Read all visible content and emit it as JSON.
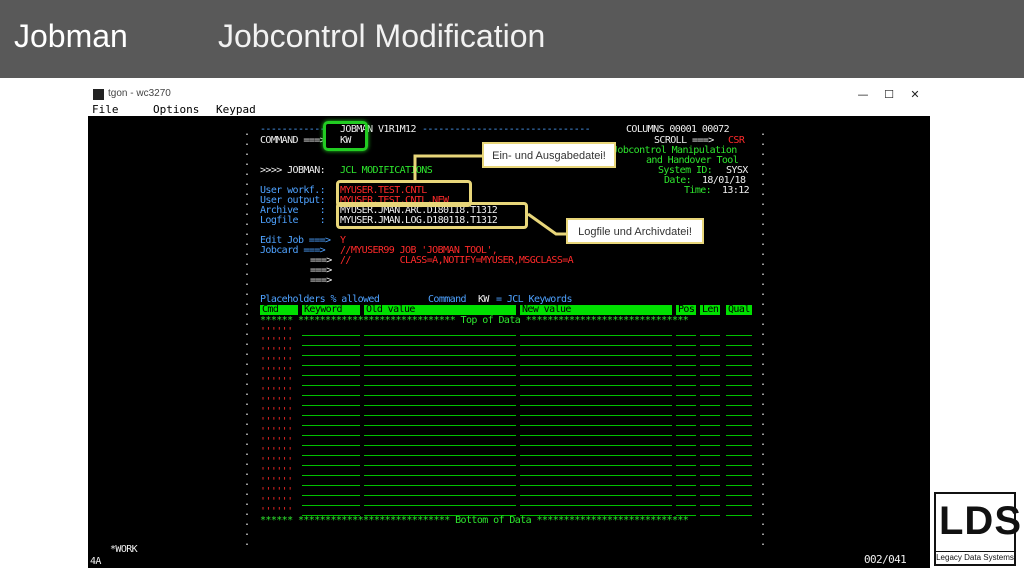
{
  "header": {
    "app_title": "Jobman",
    "page_title": "Jobcontrol Modification"
  },
  "window": {
    "title": "tgon - wc3270",
    "controls": [
      "—",
      "☐",
      "✕"
    ],
    "menu": [
      "File",
      "Options",
      "Keypad"
    ]
  },
  "terminal": {
    "banner_left": "------------",
    "banner_name": "JOBMAN V1R1M12",
    "banner_dashes": "-------------------------------",
    "columns": "COLUMNS 00001 00072",
    "command_label": "COMMAND ===>",
    "command_value": "KW",
    "scroll_label": "SCROLL ===>",
    "scroll_value": "CSR",
    "desc1": "Jobcontrol Manipulation",
    "desc2": "and Handover Tool",
    "sysid_label": "System ID:",
    "sysid_value": "SYSX",
    "date_label": "Date:",
    "date_value": "18/01/18",
    "time_label": "Time:",
    "time_value": "13:12",
    "jobman_prefix": ">>>> JOBMAN:",
    "jobman_mode": "JCL MODIFICATIONS",
    "fields": [
      {
        "label": "User workf.:",
        "value": "MYUSER.TEST.CNTL"
      },
      {
        "label": "User output:",
        "value": "MYUSER.TEST.CNTL.NEW"
      },
      {
        "label": "Archive    :",
        "value": "MYUSER.JMAN.ARC.D180118.T1312"
      },
      {
        "label": "Logfile    :",
        "value": "MYUSER.JMAN.LOG.D180118.T1312"
      }
    ],
    "editjob_label": "Edit Job ===>",
    "editjob_value": "Y",
    "jobcard_label": "Jobcard ===>",
    "jobcard_lines": [
      "//MYUSER99 JOB 'JOBMAN TOOL',",
      "//         CLASS=A,NOTIFY=MYUSER,MSGCLASS=A",
      "",
      ""
    ],
    "arrow": "===>",
    "placeholders": "Placeholders % allowed",
    "command_hint_label": "Command",
    "command_hint_kw": "KW",
    "command_hint_text": "= JCL Keywords",
    "columns_header": [
      "Cmd",
      "Keyword",
      "Old value",
      "New value",
      "Pos",
      "Len",
      "Qual"
    ],
    "top_of_data": "****** ***************************** Top of Data ******************************",
    "bottom_of_data": "****** **************************** Bottom of Data ****************************",
    "row_marker": "''''''",
    "status_left": "*WORK",
    "status_mode": "4A",
    "status_right": "002/041"
  },
  "callouts": {
    "io_datasets": "Ein- und Ausgabedatei!",
    "log_archive": "Logfile und Archivdatei!"
  },
  "logo": {
    "mark": "LDS",
    "subtitle": "Legacy Data Systems"
  },
  "colors": {
    "header_bg": "#595959",
    "terminal_bg": "#000000",
    "term_green": "#00e000",
    "term_blue": "#4ea2ff",
    "term_red": "#ff2a2a",
    "highlight_green": "#22cc22",
    "highlight_yellow": "#e8d67a"
  }
}
